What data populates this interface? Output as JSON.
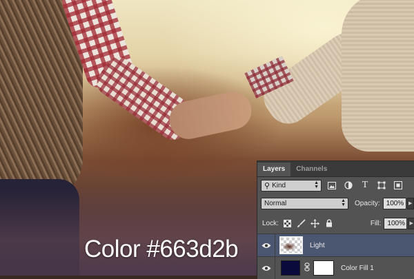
{
  "caption": {
    "text": "Color #663d2b"
  },
  "panel": {
    "tabs": [
      {
        "label": "Layers",
        "active": true
      },
      {
        "label": "Channels",
        "active": false
      }
    ],
    "filter": {
      "kind_label": "Kind",
      "icons": [
        "image-filter-icon",
        "adjustment-filter-icon",
        "type-filter-icon",
        "shape-filter-icon",
        "smart-object-filter-icon"
      ]
    },
    "blend": {
      "mode": "Normal",
      "opacity_label": "Opacity:",
      "opacity_value": "100%"
    },
    "lock": {
      "label": "Lock:",
      "icons": [
        "lock-transparent-pixels-icon",
        "lock-image-pixels-icon",
        "lock-position-icon",
        "lock-all-icon"
      ],
      "fill_label": "Fill:",
      "fill_value": "100%"
    },
    "layers": [
      {
        "name": "Light",
        "selected": true,
        "visible": true
      },
      {
        "name": "Color Fill 1",
        "selected": false,
        "visible": true,
        "fill_color": "#0a0a3c"
      }
    ]
  }
}
